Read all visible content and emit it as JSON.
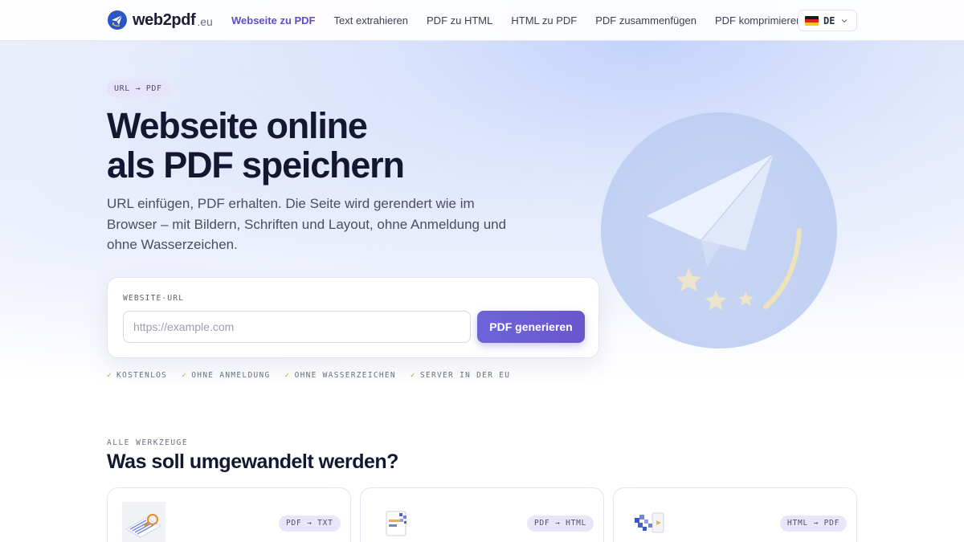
{
  "brand": {
    "name": "web2pdf",
    "tld": ".eu"
  },
  "nav": {
    "links": [
      {
        "label": "Webseite zu PDF",
        "active": true
      },
      {
        "label": "Text extrahieren",
        "active": false
      },
      {
        "label": "PDF zu HTML",
        "active": false
      },
      {
        "label": "HTML zu PDF",
        "active": false
      },
      {
        "label": "PDF zusammenfügen",
        "active": false
      },
      {
        "label": "PDF komprimieren",
        "active": false
      }
    ],
    "language": {
      "code": "DE",
      "flag": "germany-flag-icon"
    }
  },
  "hero": {
    "tag": "URL → PDF",
    "title_line1": "Webseite online",
    "title_line2": "als PDF speichern",
    "subtitle": "URL einfügen, PDF erhalten. Die Seite wird gerendert wie im Browser – mit Bildern, Schriften und Layout, ohne Anmeldung und ohne Wasserzeichen.",
    "form": {
      "label": "WEBSITE-URL",
      "placeholder": "https://example.com",
      "value": "",
      "button": "PDF generieren"
    },
    "features": [
      "KOSTENLOS",
      "OHNE ANMELDUNG",
      "OHNE WASSERZEICHEN",
      "SERVER IN DER EU"
    ],
    "check_symbol": "✓",
    "illustration": "paper-plane-stars-icon"
  },
  "tools_section": {
    "eyebrow": "ALLE WERKZEUGE",
    "title": "Was soll umgewandelt werden?",
    "cards": [
      {
        "badge": "PDF → TXT",
        "icon": "text-extract-icon"
      },
      {
        "badge": "PDF → HTML",
        "icon": "pdf-to-html-icon"
      },
      {
        "badge": "HTML → PDF",
        "icon": "html-to-pdf-icon"
      }
    ]
  },
  "colors": {
    "accent": "#5a4fcf",
    "button_start": "#6d64d8",
    "button_end": "#6b55cc",
    "check": "#c79a2b",
    "logo_blue": "#2a55c7"
  }
}
